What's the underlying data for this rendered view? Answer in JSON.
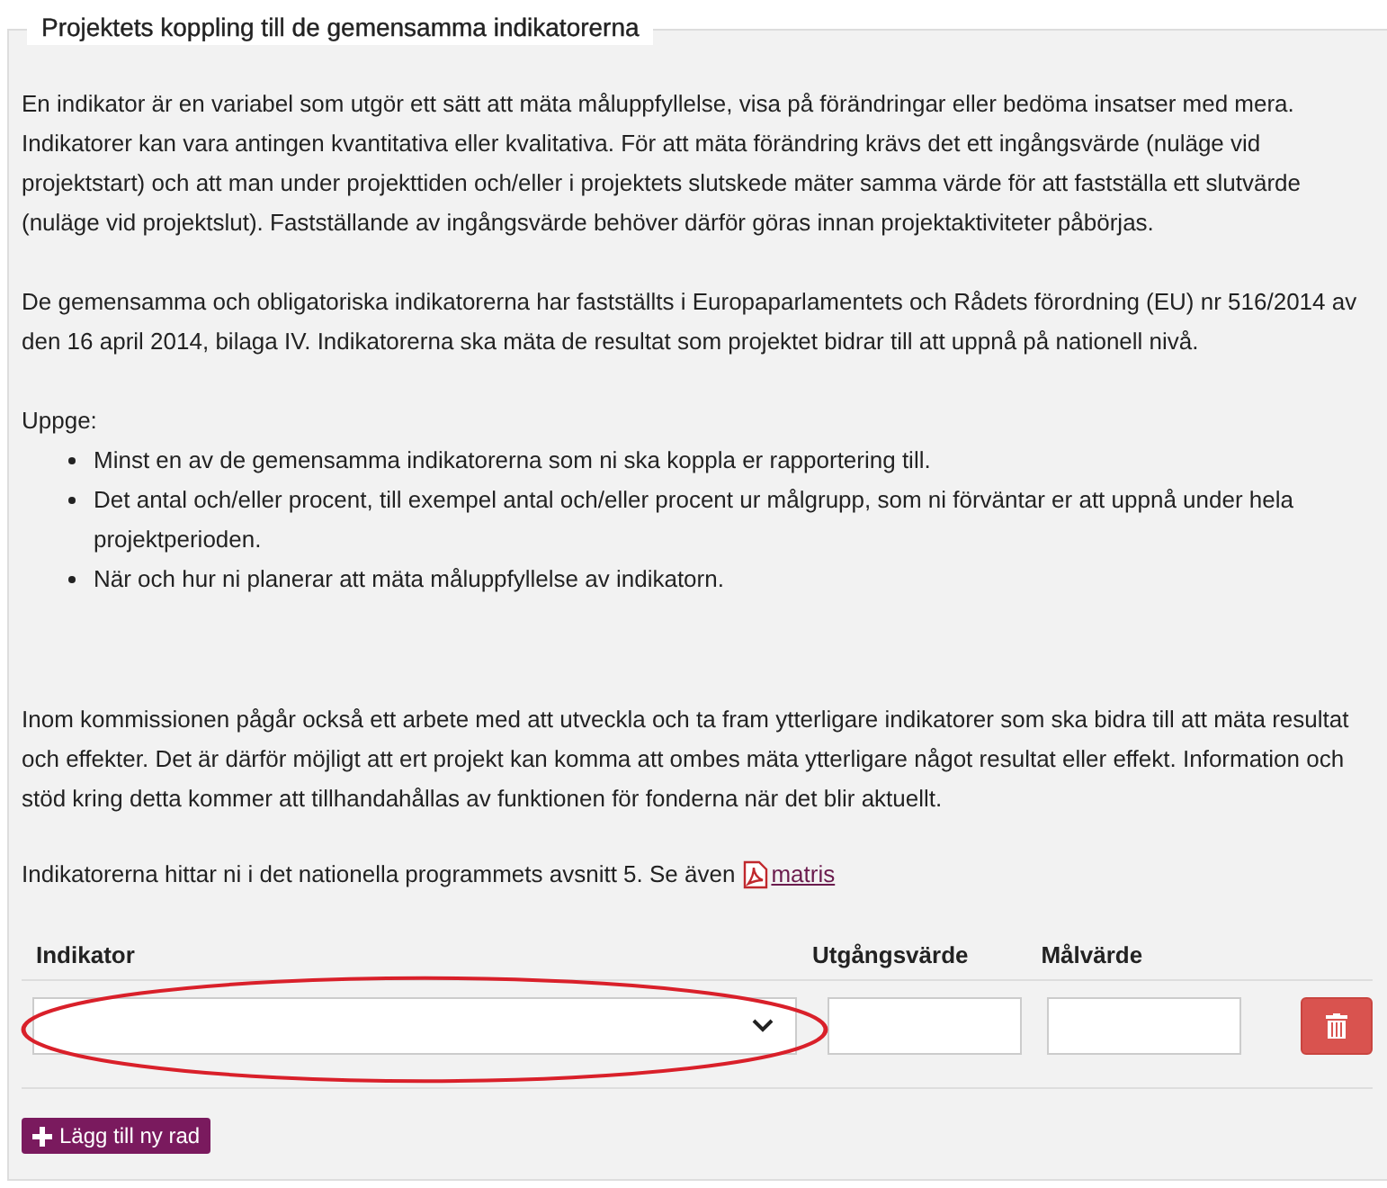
{
  "section": {
    "title": "Projektets koppling till de gemensamma indikatorerna",
    "intro": [
      "En indikator är en variabel som utgör ett sätt att mäta måluppfyllelse, visa på förändringar eller bedöma insatser med mera. Indikatorer kan vara antingen kvantitativa eller kvalitativa. För att mäta förändring krävs det ett ingångsvärde (nuläge vid projektstart) och att man under projekttiden och/eller i projektets slutskede mäter samma värde för att fastställa ett slutvärde (nuläge vid projektslut). Fastställande av ingångsvärde behöver därför göras innan projektaktiviteter påbörjas.",
      "De gemensamma och obligatoriska indikatorerna har fastställts i Europaparlamentets och Rådets förordning (EU) nr 516/2014 av den 16 april 2014, bilaga IV. Indikatorerna ska mäta de resultat som projektet bidrar till att uppnå på nationell nivå."
    ],
    "list_title": "Uppge:",
    "list": [
      "Minst en av de gemensamma indikatorerna som ni ska koppla er rapportering till.",
      "Det antal och/eller procent, till exempel antal och/eller procent ur målgrupp, som ni förväntar er att uppnå under hela projektperioden.",
      "När och hur ni planerar att mäta måluppfyllelse av indikatorn."
    ],
    "outro": "Inom kommissionen pågår också ett arbete med att utveckla och ta fram ytterligare indikatorer som ska bidra till att mäta resultat och effekter. Det är därför möjligt att ert projekt kan komma att ombes mäta ytterligare något resultat eller effekt. Information och stöd kring detta kommer att tillhandahållas av funktionen för fonderna när det blir aktuellt.",
    "reference": {
      "text": "Indikatorerna hittar ni i det nationella programmets avsnitt 5. Se även",
      "link": "matris"
    },
    "table": {
      "columns": [
        "Indikator",
        "Utgångsvärde",
        "Målvärde"
      ],
      "rows": [
        {
          "indicator_highlighted": true
        }
      ]
    },
    "add_button": "Lägg till ny rad"
  }
}
